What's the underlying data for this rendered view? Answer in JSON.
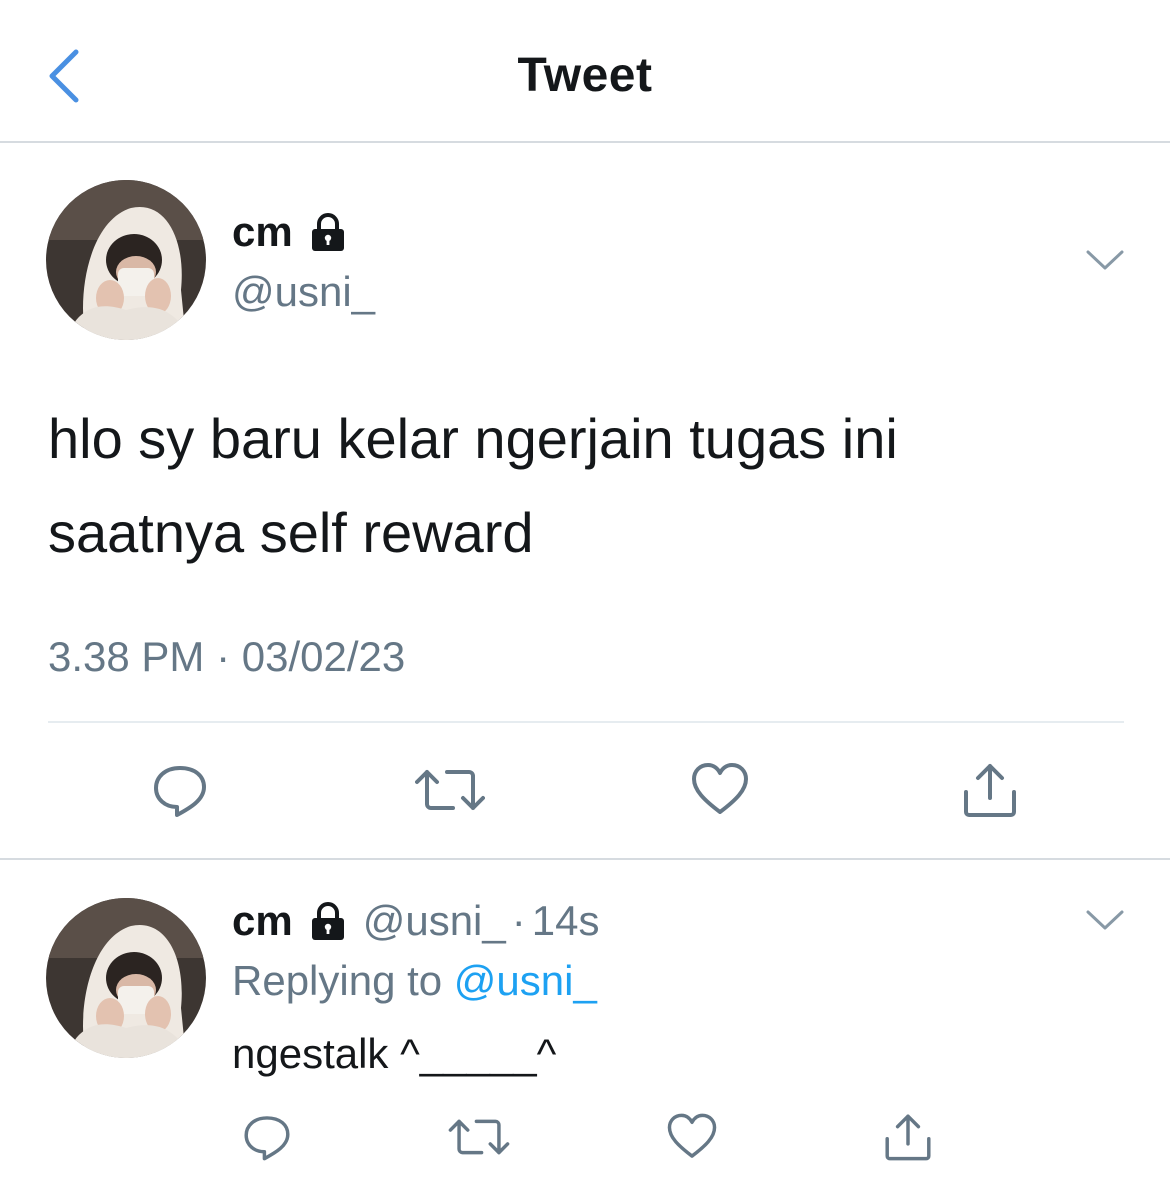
{
  "header": {
    "title": "Tweet",
    "back_icon": "chevron-left-icon"
  },
  "colors": {
    "accent": "#1da1f2",
    "back_arrow": "#4a90e2",
    "text": "#14171a",
    "secondary": "#657786",
    "divider": "#d6dbe0"
  },
  "main_tweet": {
    "display_name": "cm",
    "handle": "@usni_",
    "protected_icon": "lock-icon",
    "menu_icon": "chevron-down-icon",
    "text_lines": [
      "hlo sy baru kelar ngerjain tugas ini",
      "saatnya self reward"
    ],
    "timestamp": "3.38 PM · 03/02/23",
    "actions": [
      {
        "icon": "reply-icon"
      },
      {
        "icon": "retweet-icon"
      },
      {
        "icon": "like-icon"
      },
      {
        "icon": "share-icon"
      }
    ]
  },
  "reply_tweet": {
    "display_name": "cm",
    "handle": "@usni_",
    "separator": "·",
    "time": "14s",
    "replying_prefix": "Replying to",
    "replying_handle": "@usni_",
    "text": "ngestalk ^_____^",
    "actions": [
      {
        "icon": "reply-icon"
      },
      {
        "icon": "retweet-icon"
      },
      {
        "icon": "like-icon"
      },
      {
        "icon": "share-icon"
      }
    ]
  }
}
